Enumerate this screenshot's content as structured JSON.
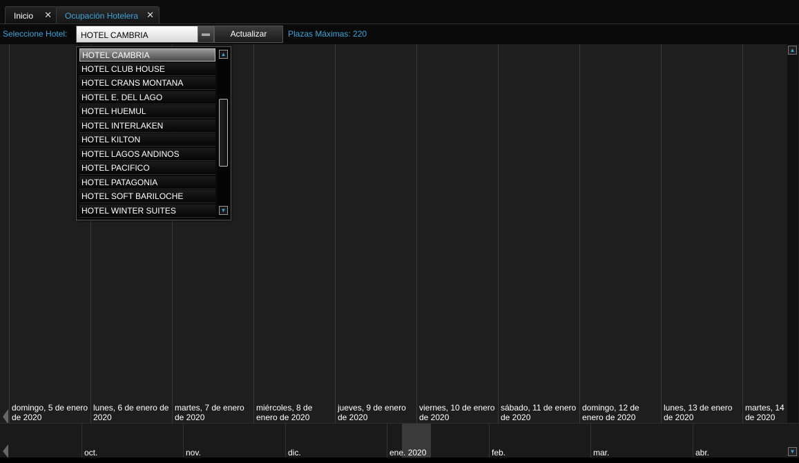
{
  "tabs": [
    {
      "label": "Inicio",
      "close": "✕"
    },
    {
      "label": "Ocupación Hotelera",
      "close": "✕"
    }
  ],
  "toolbar": {
    "hotel_label": "Seleccione Hotel:",
    "selected_hotel": "HOTEL CAMBRIA",
    "refresh_label": "Actualizar",
    "plazas_label": "Plazas Máximas:",
    "plazas_value": "220"
  },
  "dropdown": {
    "items": [
      "HOTEL CAMBRIA",
      "HOTEL CLUB HOUSE",
      "HOTEL CRANS MONTANA",
      "HOTEL E. DEL LAGO",
      "HOTEL HUEMUL",
      "HOTEL INTERLAKEN",
      "HOTEL KILTON",
      "HOTEL LAGOS ANDINOS",
      "HOTEL PACIFICO",
      "HOTEL PATAGONIA",
      "HOTEL SOFT BARILOCHE",
      "HOTEL WINTER SUITES"
    ],
    "selected_index": 0
  },
  "days": [
    {
      "line1": "domingo, 5 de enero",
      "line2": "de 2020"
    },
    {
      "line1": "lunes, 6 de enero de",
      "line2": "2020"
    },
    {
      "line1": "martes, 7 de enero",
      "line2": "de 2020"
    },
    {
      "line1": "miércoles, 8 de",
      "line2": "enero de 2020"
    },
    {
      "line1": "jueves, 9 de enero",
      "line2": "de 2020"
    },
    {
      "line1": "viernes, 10 de enero",
      "line2": "de 2020"
    },
    {
      "line1": "sábado, 11 de enero",
      "line2": "de 2020"
    },
    {
      "line1": "domingo, 12 de",
      "line2": "enero de 2020"
    },
    {
      "line1": "lunes, 13 de enero",
      "line2": "de 2020"
    },
    {
      "line1": "martes, 14",
      "line2": "de 2020"
    }
  ],
  "months": [
    "oct.",
    "nov.",
    "dic.",
    "ene. 2020",
    "feb.",
    "mar.",
    "abr."
  ],
  "colors": {
    "accent": "#3fa4d8",
    "background": "#1e1e1e"
  }
}
